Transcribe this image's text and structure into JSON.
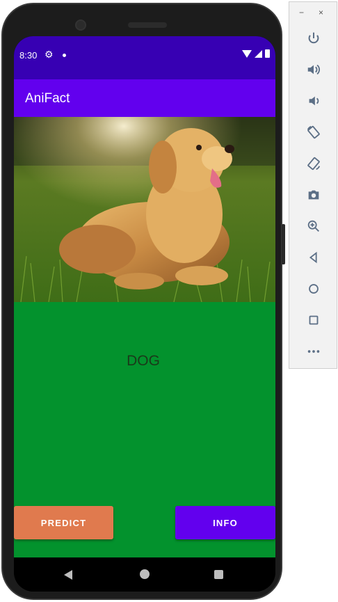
{
  "status_bar": {
    "time": "8:30",
    "settings_icon": "gear-icon"
  },
  "app": {
    "title": "AniFact"
  },
  "result": {
    "label": "DOG"
  },
  "buttons": {
    "predict": "PREDICT",
    "info": "INFO"
  },
  "colors": {
    "status_bar": "#3700b3",
    "app_bar": "#6200ee",
    "content_bg": "#03922d",
    "predict_button": "#e07a4e",
    "info_button": "#6200ee"
  },
  "emulator_toolbar": {
    "window_minimize": "−",
    "window_close": "×",
    "icons": [
      "power-icon",
      "volume-up-icon",
      "volume-down-icon",
      "rotate-left-icon",
      "rotate-right-icon",
      "camera-icon",
      "zoom-icon",
      "back-icon",
      "home-icon",
      "overview-icon",
      "more-icon"
    ]
  }
}
